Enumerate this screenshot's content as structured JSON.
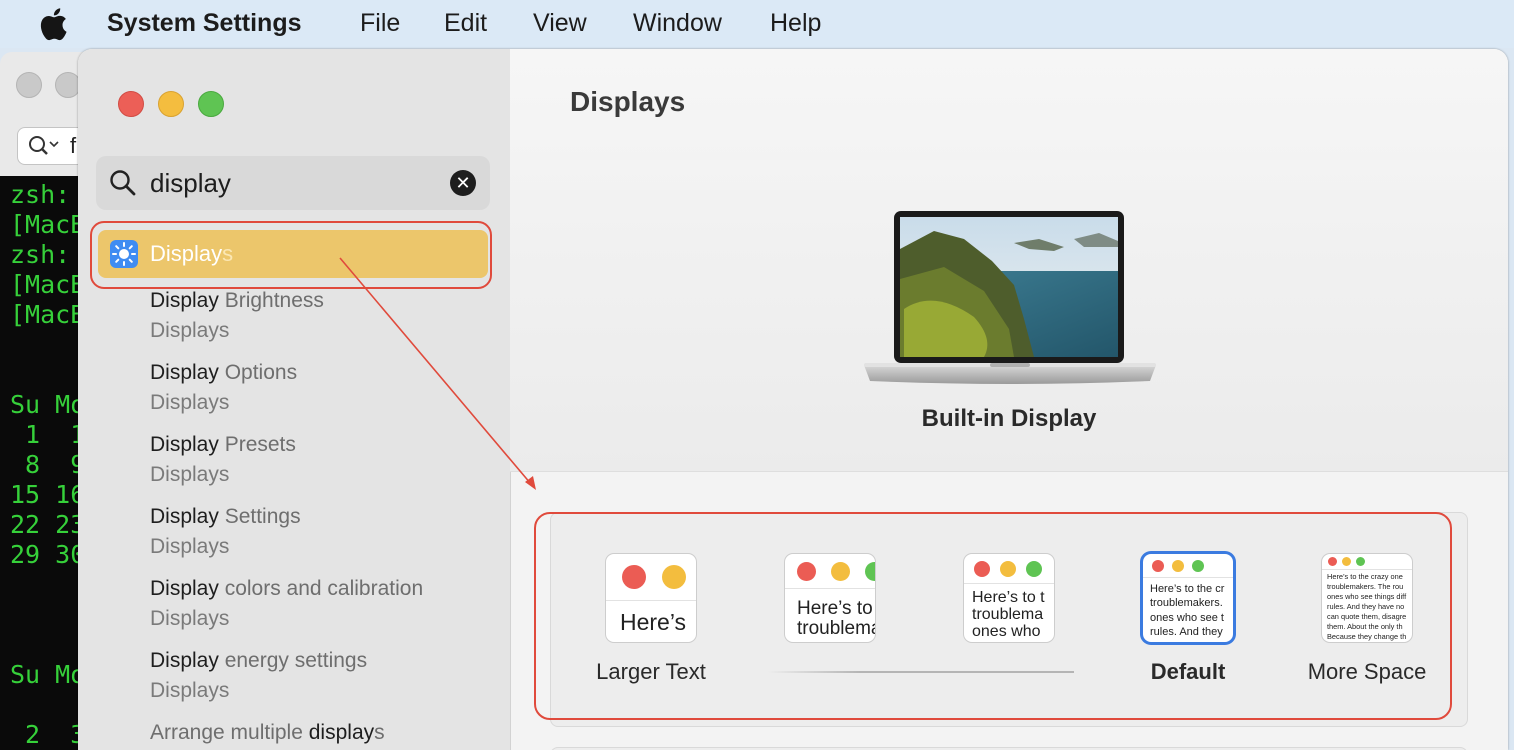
{
  "menubar": {
    "app_name": "System Settings",
    "items": [
      "File",
      "Edit",
      "View",
      "Window",
      "Help"
    ]
  },
  "terminal": {
    "search_prefix": "f",
    "lines": [
      "zsh:",
      "[MacBo",
      "zsh:",
      "[MacBo",
      "[MacBo",
      "Su Mo",
      " 1  1",
      " 8  9",
      "15 16",
      "22 23",
      "29 30",
      "Su Mo",
      " 2  3"
    ]
  },
  "sidebar": {
    "search": {
      "query": "display"
    },
    "selected": {
      "label_match": "Display",
      "label_rest": "s"
    },
    "results": [
      {
        "match": "Display",
        "rest": " Brightness",
        "sub": "Displays"
      },
      {
        "match": "Display",
        "rest": " Options",
        "sub": "Displays"
      },
      {
        "match": "Display",
        "rest": " Presets",
        "sub": "Displays"
      },
      {
        "match": "Display",
        "rest": " Settings",
        "sub": "Displays"
      },
      {
        "match": "Display",
        "rest": " colors and calibration",
        "sub": "Displays"
      },
      {
        "match": "Display",
        "rest": " energy settings",
        "sub": "Displays"
      },
      {
        "pre": "Arrange multiple ",
        "match": "display",
        "rest": "s"
      }
    ]
  },
  "content": {
    "title": "Displays",
    "display_name": "Built-in Display",
    "resolution_options": [
      {
        "label": "Larger Text",
        "preview": "Here’s"
      },
      {
        "label": "",
        "preview": "Here’s to\ntroublema"
      },
      {
        "label": "",
        "preview": "Here’s to t\ntroublema\nones who"
      },
      {
        "label": "Default",
        "preview": "Here’s to the cr\ntroublemakers.\nones who see t\nrules. And they"
      },
      {
        "label": "More Space",
        "preview": "Here’s to the crazy one\ntroublemakers. The rou\nones who see things diff\nrules. And they have no\ncan quote them, disagre\nthem. About the only th\nBecause they change th"
      }
    ],
    "selected_option": "Default"
  },
  "colors": {
    "accent": "#3b7be0",
    "selection": "#ecc66b",
    "annotation": "#e04a3c",
    "terminal_text": "#36d13a"
  }
}
